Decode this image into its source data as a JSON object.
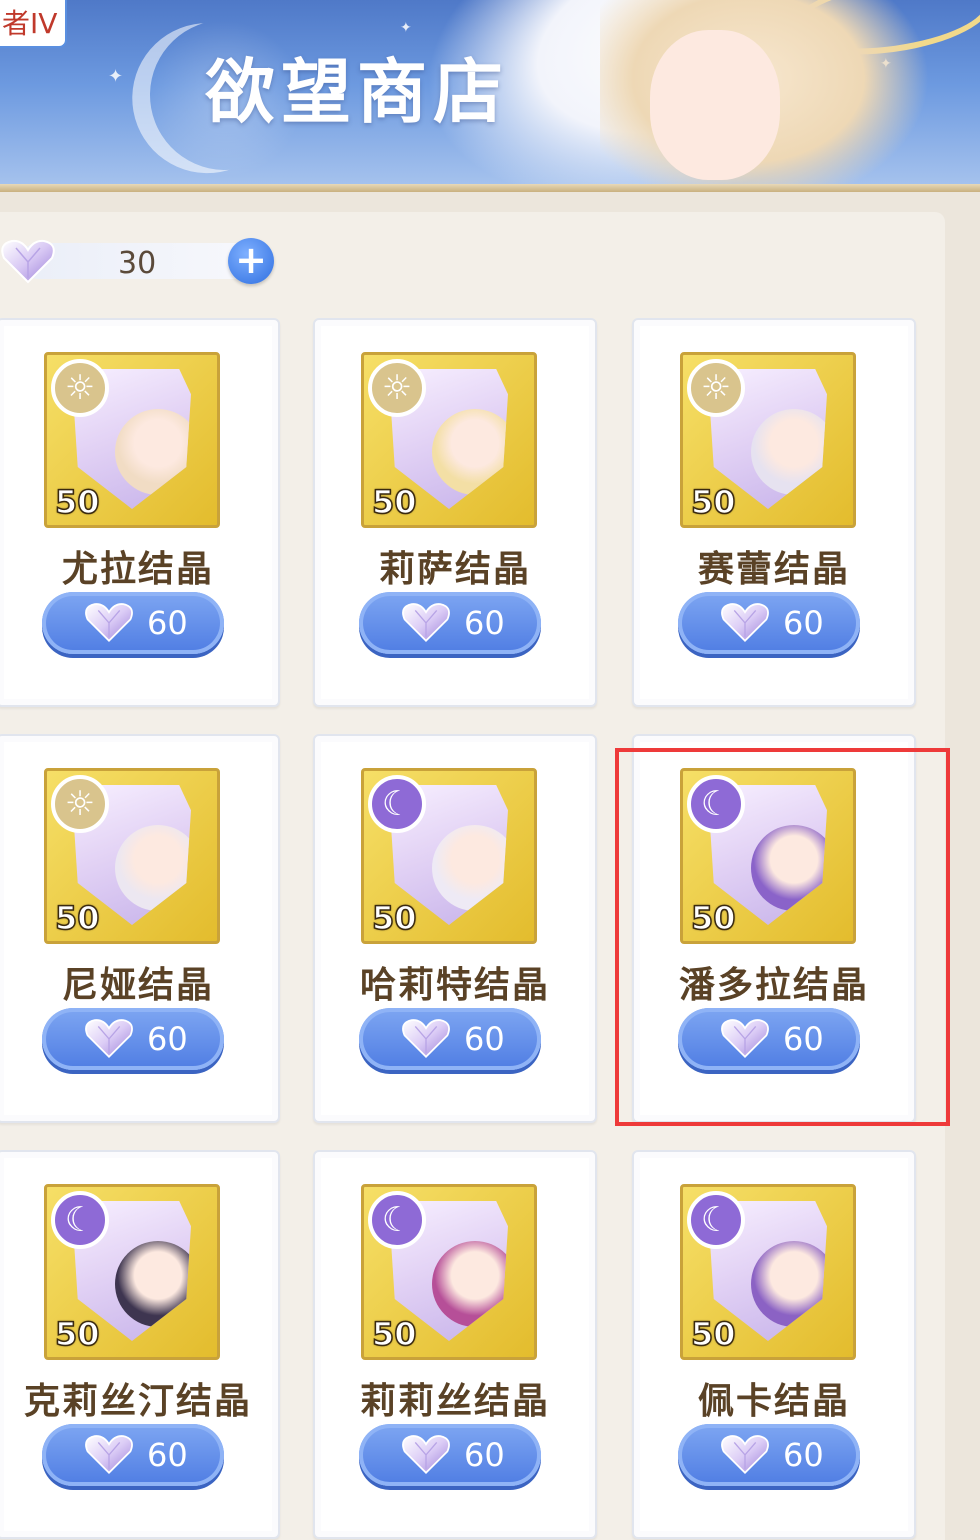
{
  "banner": {
    "title": "欲望商店",
    "corner_tag": "者IV"
  },
  "currency": {
    "icon": "crystal-heart-icon",
    "value": "30",
    "add_icon": "plus-icon"
  },
  "colors": {
    "price_button": "#4f7de3",
    "frame_gold": "#e3bc2d",
    "highlight": "#ee3a3a",
    "sun_element": "#d9c48d",
    "moon_element": "#8e6ad6"
  },
  "items": [
    {
      "name": "尤拉结晶",
      "level": "50",
      "price": "60",
      "element": "sun",
      "portrait_color": "#f1dcc4"
    },
    {
      "name": "莉萨结晶",
      "level": "50",
      "price": "60",
      "element": "sun",
      "portrait_color": "#f3dfa5"
    },
    {
      "name": "赛蕾结晶",
      "level": "50",
      "price": "60",
      "element": "sun",
      "portrait_color": "#e6e2f0"
    },
    {
      "name": "尼娅结晶",
      "level": "50",
      "price": "60",
      "element": "sun",
      "portrait_color": "#ece7f1"
    },
    {
      "name": "哈莉特结晶",
      "level": "50",
      "price": "60",
      "element": "moon",
      "portrait_color": "#eeeaf5"
    },
    {
      "name": "潘多拉结晶",
      "level": "50",
      "price": "60",
      "element": "moon",
      "portrait_color": "#8a63c9"
    },
    {
      "name": "克莉丝汀结晶",
      "level": "50",
      "price": "60",
      "element": "moon",
      "portrait_color": "#3e3550"
    },
    {
      "name": "莉莉丝结晶",
      "level": "50",
      "price": "60",
      "element": "moon",
      "portrait_color": "#b64f98"
    },
    {
      "name": "佩卡结晶",
      "level": "50",
      "price": "60",
      "element": "moon",
      "portrait_color": "#8b62c4"
    }
  ]
}
